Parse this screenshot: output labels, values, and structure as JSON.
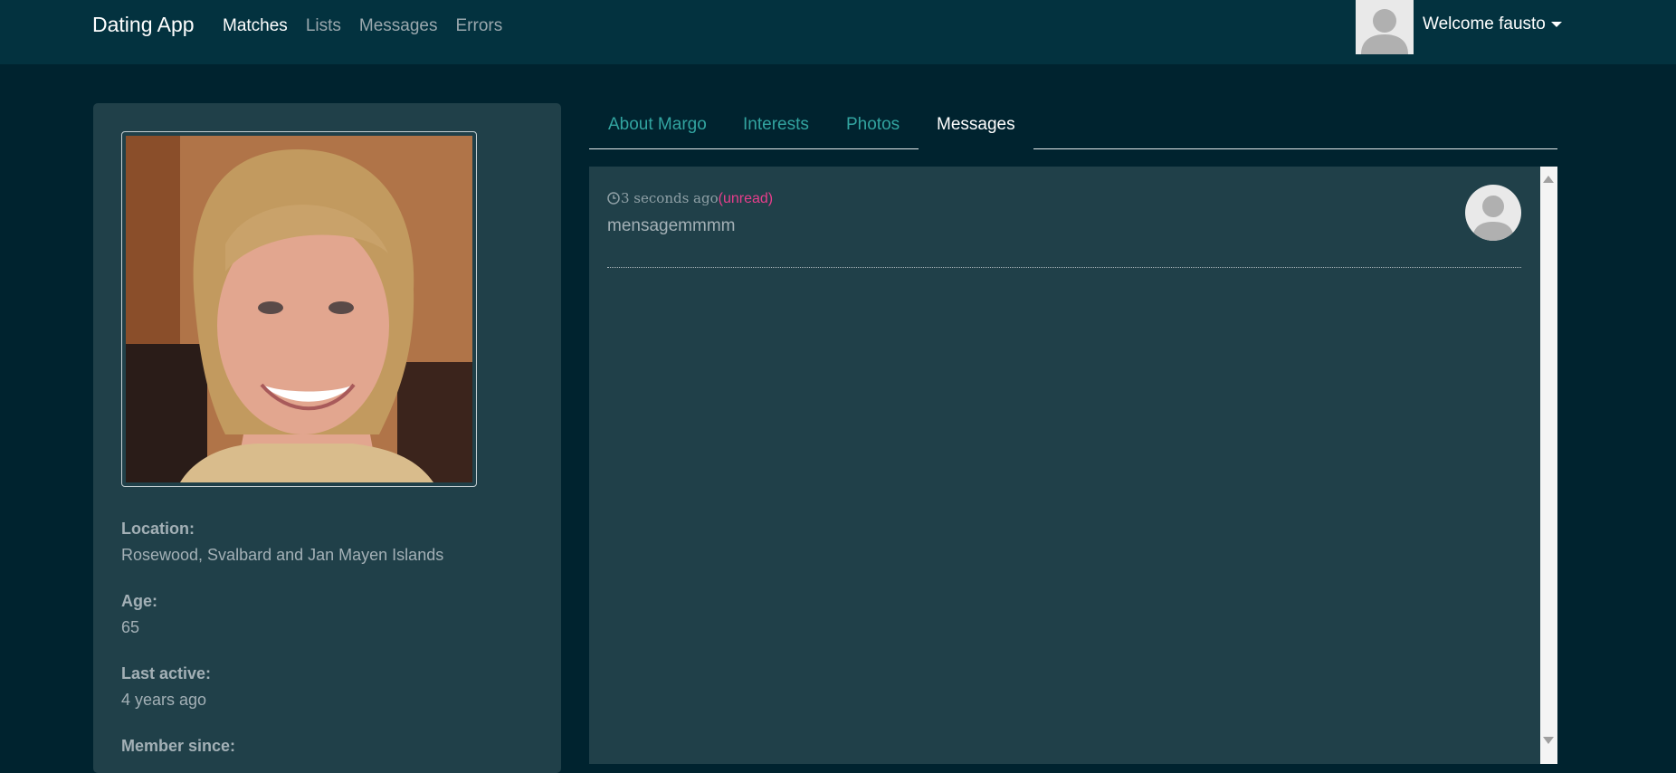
{
  "navbar": {
    "brand": "Dating App",
    "links": [
      "Matches",
      "Lists",
      "Messages",
      "Errors"
    ],
    "active_link": "Matches",
    "welcome": "Welcome fausto",
    "avatar_icon": "user-placeholder-icon"
  },
  "profile": {
    "photo_icon": "member-photo",
    "location_label": "Location:",
    "location": "Rosewood, Svalbard and Jan Mayen Islands",
    "age_label": "Age:",
    "age": "65",
    "last_active_label": "Last active:",
    "last_active": "4 years ago",
    "member_since_label": "Member since:"
  },
  "tabs": {
    "items": [
      "About Margo",
      "Interests",
      "Photos",
      "Messages"
    ],
    "active": "Messages"
  },
  "messages": [
    {
      "time": "3 seconds ago",
      "status": "(unread)",
      "content": "mensagemmmm",
      "avatar_icon": "user-placeholder-icon"
    }
  ],
  "colors": {
    "background": "#00232f",
    "navbar": "#03323f",
    "card": "#204049",
    "tab_link": "#32a4a0",
    "unread": "#e83e8c"
  }
}
